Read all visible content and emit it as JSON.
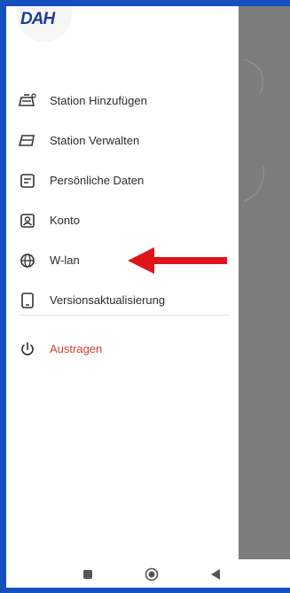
{
  "app": {
    "logo_text": "DAH"
  },
  "menu": {
    "items": [
      {
        "label": "Station Hinzufügen",
        "icon": "station-add-icon"
      },
      {
        "label": "Station Verwalten",
        "icon": "station-manage-icon"
      },
      {
        "label": "Persönliche Daten",
        "icon": "personal-data-icon"
      },
      {
        "label": "Konto",
        "icon": "account-icon"
      },
      {
        "label": "W-lan",
        "icon": "globe-icon"
      },
      {
        "label": "Versionsaktualisierung",
        "icon": "tablet-icon"
      }
    ],
    "logout": {
      "label": "Austragen",
      "icon": "power-icon"
    }
  },
  "colors": {
    "frame": "#1650bf",
    "overlay": "#7d7d7d",
    "logout": "#d43c2c",
    "arrow": "#e0151c"
  },
  "navbar": {
    "buttons": [
      "recent-apps-icon",
      "home-icon",
      "back-icon"
    ]
  }
}
